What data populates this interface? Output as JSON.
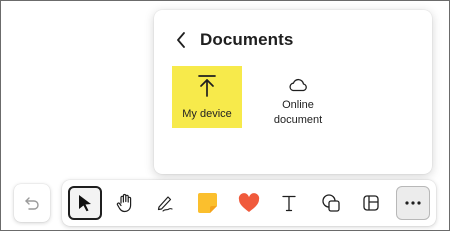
{
  "popup": {
    "title": "Documents",
    "back_icon": "chevron-left-icon",
    "options": [
      {
        "label": "My device",
        "icon": "upload-icon",
        "selected": true,
        "highlight_color": "#f7ea4b"
      },
      {
        "label_line1": "Online",
        "label_line2": "document",
        "icon": "cloud-icon",
        "selected": false
      }
    ]
  },
  "toolbar": {
    "undo_icon": "undo-icon",
    "tools": [
      {
        "icon": "pointer-arrow-icon",
        "active": true
      },
      {
        "icon": "hand-pan-icon"
      },
      {
        "icon": "pen-icon"
      },
      {
        "icon": "sticky-note-icon",
        "color": "#fbbf2d"
      },
      {
        "icon": "heart-reaction-icon",
        "color": "#f05a3c"
      },
      {
        "icon": "text-icon"
      },
      {
        "icon": "shapes-icon"
      },
      {
        "icon": "templates-icon"
      },
      {
        "icon": "more-options-icon"
      }
    ]
  }
}
